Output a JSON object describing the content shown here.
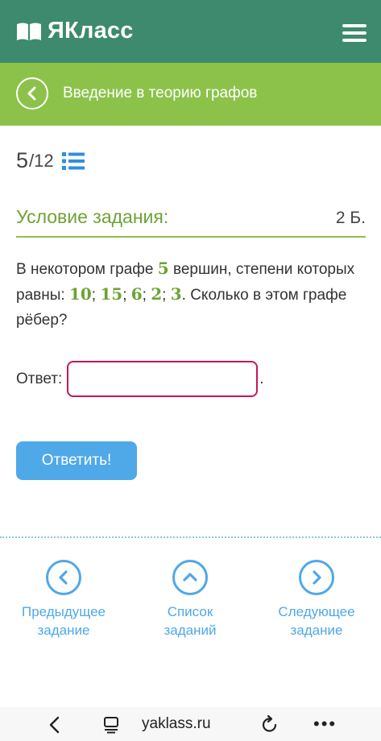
{
  "header": {
    "logo_text": "ЯКласс",
    "logo_icon": "book-icon",
    "menu_icon": "hamburger-menu-icon"
  },
  "lesson": {
    "title": "Введение в теорию графов",
    "back_icon": "chevron-left-circle-icon"
  },
  "progress": {
    "current": "5",
    "separator": "/",
    "total": "12",
    "list_icon": "list-icon"
  },
  "condition": {
    "title": "Условие задания:",
    "points": "2 Б."
  },
  "task": {
    "part1": "В некотором графе ",
    "vertices": "5",
    "part2": " вершин, степени которых равны: ",
    "deg1": "10",
    "deg2": "15",
    "deg3": "6",
    "deg4": "2",
    "deg5": "3",
    "sep": "; ",
    "part3": ". Сколько в этом графе рёбер?"
  },
  "answer": {
    "label": "Ответ:",
    "value": "",
    "placeholder": "",
    "trailing": "."
  },
  "submit_label": "Ответить!",
  "nav": {
    "prev_line1": "Предыдущее",
    "prev_line2": "задание",
    "list_line1": "Список",
    "list_line2": "заданий",
    "next_line1": "Следующее",
    "next_line2": "задание"
  },
  "browser": {
    "url": "yaklass.ru",
    "more": "•••"
  },
  "colors": {
    "header_bg": "#3d8a6e",
    "lesson_bg": "#8cc24a",
    "accent_green": "#6ea234",
    "link_blue": "#4fa8e8",
    "input_border": "#c2185b"
  }
}
